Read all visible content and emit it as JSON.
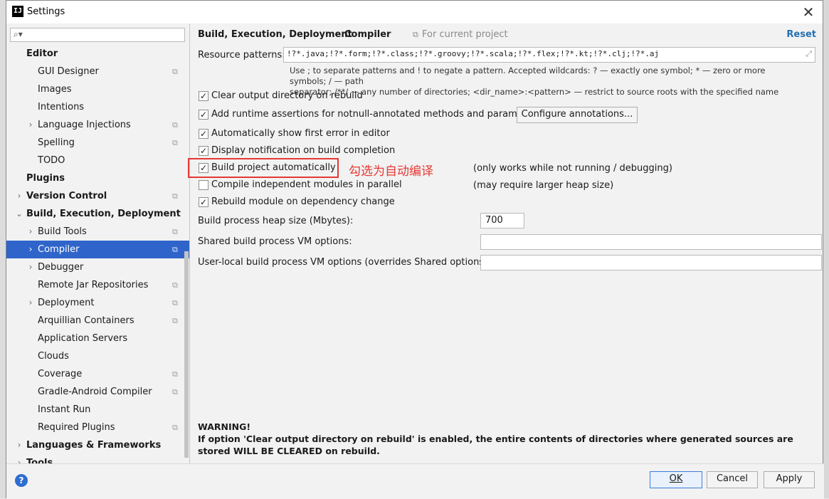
{
  "window": {
    "title": "Settings",
    "app_icon": "IJ"
  },
  "sidebar": {
    "search_placeholder": "",
    "items": [
      {
        "label": "Editor",
        "bold": true,
        "indent": 1,
        "arrow": "",
        "proj": false
      },
      {
        "label": "GUI Designer",
        "bold": false,
        "indent": 2,
        "arrow": "",
        "proj": true
      },
      {
        "label": "Images",
        "bold": false,
        "indent": 2,
        "arrow": "",
        "proj": false
      },
      {
        "label": "Intentions",
        "bold": false,
        "indent": 2,
        "arrow": "",
        "proj": false
      },
      {
        "label": "Language Injections",
        "bold": false,
        "indent": 2,
        "arrow": "›",
        "proj": true
      },
      {
        "label": "Spelling",
        "bold": false,
        "indent": 2,
        "arrow": "",
        "proj": true
      },
      {
        "label": "TODO",
        "bold": false,
        "indent": 2,
        "arrow": "",
        "proj": false
      },
      {
        "label": "Plugins",
        "bold": true,
        "indent": 1,
        "arrow": "",
        "proj": false
      },
      {
        "label": "Version Control",
        "bold": true,
        "indent": 1,
        "arrow": "›",
        "proj": true
      },
      {
        "label": "Build, Execution, Deployment",
        "bold": true,
        "indent": 1,
        "arrow": "⌄",
        "proj": false
      },
      {
        "label": "Build Tools",
        "bold": false,
        "indent": 2,
        "arrow": "›",
        "proj": true
      },
      {
        "label": "Compiler",
        "bold": false,
        "indent": 2,
        "arrow": "›",
        "proj": true,
        "selected": true
      },
      {
        "label": "Debugger",
        "bold": false,
        "indent": 2,
        "arrow": "›",
        "proj": false
      },
      {
        "label": "Remote Jar Repositories",
        "bold": false,
        "indent": 2,
        "arrow": "",
        "proj": true
      },
      {
        "label": "Deployment",
        "bold": false,
        "indent": 2,
        "arrow": "›",
        "proj": true
      },
      {
        "label": "Arquillian Containers",
        "bold": false,
        "indent": 2,
        "arrow": "",
        "proj": true
      },
      {
        "label": "Application Servers",
        "bold": false,
        "indent": 2,
        "arrow": "",
        "proj": false
      },
      {
        "label": "Clouds",
        "bold": false,
        "indent": 2,
        "arrow": "",
        "proj": false
      },
      {
        "label": "Coverage",
        "bold": false,
        "indent": 2,
        "arrow": "",
        "proj": true
      },
      {
        "label": "Gradle-Android Compiler",
        "bold": false,
        "indent": 2,
        "arrow": "",
        "proj": true
      },
      {
        "label": "Instant Run",
        "bold": false,
        "indent": 2,
        "arrow": "",
        "proj": false
      },
      {
        "label": "Required Plugins",
        "bold": false,
        "indent": 2,
        "arrow": "",
        "proj": true
      },
      {
        "label": "Languages & Frameworks",
        "bold": true,
        "indent": 1,
        "arrow": "›",
        "proj": false
      },
      {
        "label": "Tools",
        "bold": true,
        "indent": 1,
        "arrow": "›",
        "proj": false
      }
    ]
  },
  "breadcrumb": {
    "parent": "Build, Execution, Deployment",
    "separator": "›",
    "current": "Compiler",
    "for_current_project": "For current project",
    "reset": "Reset"
  },
  "resource_patterns": {
    "label": "Resource patterns:",
    "value": "!?*.java;!?*.form;!?*.class;!?*.groovy;!?*.scala;!?*.flex;!?*.kt;!?*.clj;!?*.aj",
    "hint_line1": "Use ; to separate patterns and ! to negate a pattern. Accepted wildcards: ? — exactly one symbol; * — zero or more symbols; / — path",
    "hint_line2": "separator; /**/ — any number of directories; <dir_name>:<pattern> — restrict to source roots with the specified name"
  },
  "options": {
    "clear_output": {
      "label": "Clear output directory on rebuild",
      "checked": true
    },
    "runtime_assertions": {
      "label": "Add runtime assertions for notnull-annotated methods and parameters",
      "checked": true
    },
    "configure_annotations": "Configure annotations...",
    "show_first_error": {
      "label": "Automatically show first error in editor",
      "checked": true
    },
    "display_notification": {
      "label": "Display notification on build completion",
      "checked": true
    },
    "build_automatically": {
      "label": "Build project automatically",
      "checked": true,
      "note": "(only works while not running / debugging)"
    },
    "compile_parallel": {
      "label": "Compile independent modules in parallel",
      "checked": false,
      "note": "(may require larger heap size)"
    },
    "rebuild_on_dependency": {
      "label": "Rebuild module on dependency change",
      "checked": true
    }
  },
  "annotation": {
    "text": "勾选为自动编译",
    "color": "#e53935"
  },
  "heap": {
    "label": "Build process heap size (Mbytes):",
    "value": "700"
  },
  "shared_vm": {
    "label": "Shared build process VM options:",
    "value": ""
  },
  "user_local_vm": {
    "label": "User-local build process VM options (overrides Shared options):",
    "value": ""
  },
  "warning": {
    "title": "WARNING!",
    "text": "If option 'Clear output directory on rebuild' is enabled, the entire contents of directories where generated sources are stored WILL BE CLEARED on rebuild."
  },
  "footer": {
    "ok": "OK",
    "cancel": "Cancel",
    "apply": "Apply",
    "help": "?"
  },
  "colors": {
    "selection": "#2f65ca",
    "link": "#2470b3",
    "annotation": "#e53935"
  }
}
